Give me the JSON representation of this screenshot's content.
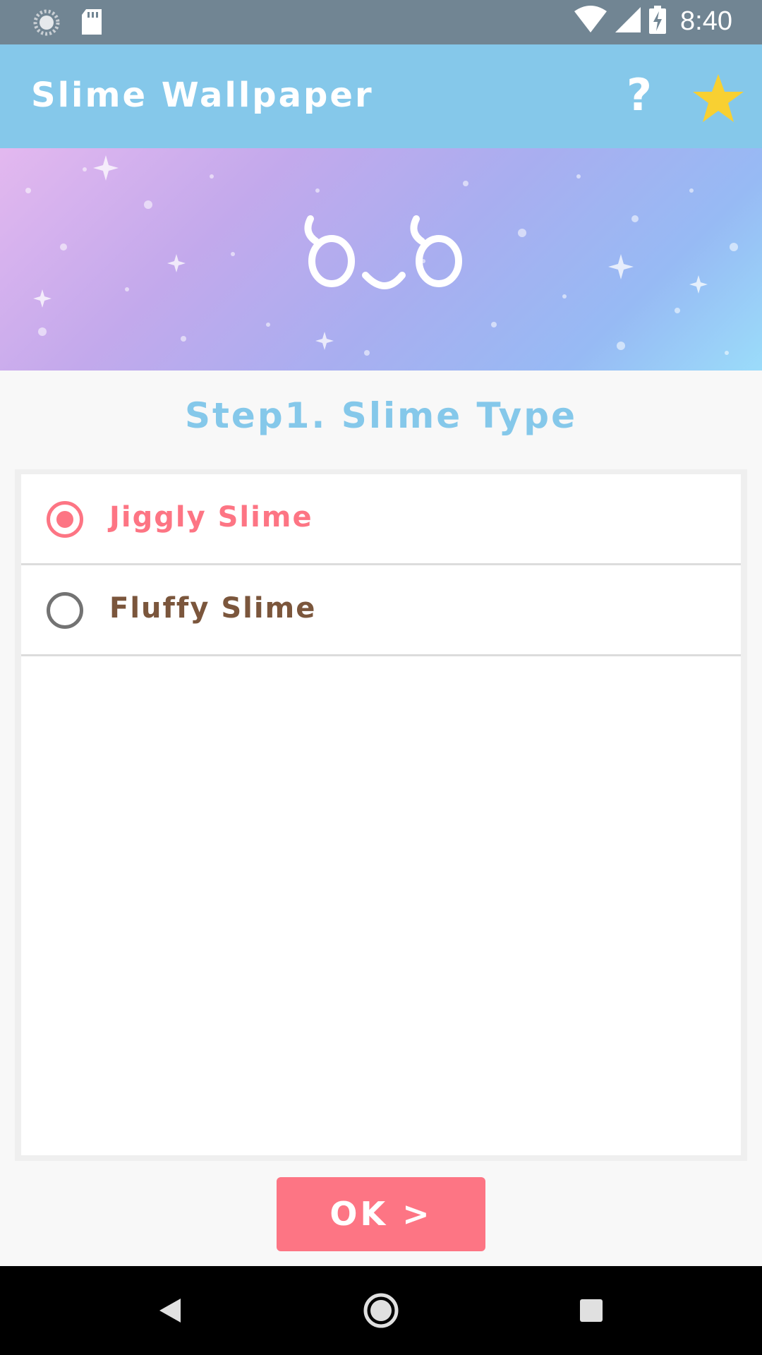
{
  "status_bar": {
    "time": "8:40",
    "icons": [
      "sync-icon",
      "sd-card-icon",
      "wifi-icon",
      "signal-icon",
      "battery-charging-icon"
    ]
  },
  "app_bar": {
    "title": "Slime Wallpaper",
    "help_label": "?",
    "icons": [
      "help-icon",
      "star-icon"
    ],
    "background_color": "#85c8ea",
    "star_color": "#f8d032"
  },
  "banner": {
    "icons": [
      "slime-face-icon"
    ]
  },
  "step": {
    "title": "Step1. Slime Type",
    "color": "#85c8ea"
  },
  "options": [
    {
      "label": "Jiggly Slime",
      "selected": true,
      "color": "#fd7584"
    },
    {
      "label": "Fluffy Slime",
      "selected": false,
      "color": "#7b563c"
    }
  ],
  "ok_button": {
    "label": "OK >",
    "color": "#fd7584"
  },
  "nav_bar": {
    "icons": [
      "back-icon",
      "home-icon",
      "recents-icon"
    ]
  }
}
